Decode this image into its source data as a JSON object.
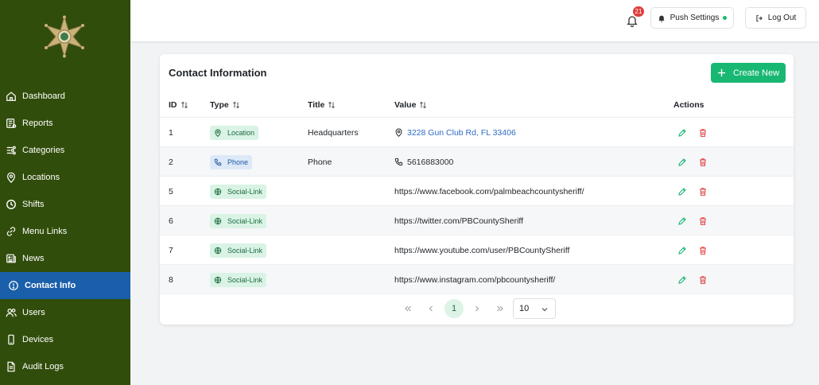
{
  "sidebar": {
    "items": [
      {
        "label": "Dashboard"
      },
      {
        "label": "Reports"
      },
      {
        "label": "Categories"
      },
      {
        "label": "Locations"
      },
      {
        "label": "Shifts"
      },
      {
        "label": "Menu Links"
      },
      {
        "label": "News"
      },
      {
        "label": "Contact Info"
      },
      {
        "label": "Users"
      },
      {
        "label": "Devices"
      },
      {
        "label": "Audit Logs"
      }
    ],
    "active_index": 7,
    "background": "#314d0b",
    "active_color": "#1a5faa"
  },
  "header": {
    "notification_count": "21",
    "push_settings_label": "Push Settings",
    "logout_label": "Log Out"
  },
  "card": {
    "title": "Contact Information",
    "create_label": "Create New",
    "columns": {
      "id": "ID",
      "type": "Type",
      "title": "Title",
      "value": "Value",
      "actions": "Actions"
    },
    "rows": [
      {
        "id": "1",
        "type": "Location",
        "title": "Headquarters",
        "value": "3228 Gun Club Rd, FL 33406"
      },
      {
        "id": "2",
        "type": "Phone",
        "title": "Phone",
        "value": "5616883000"
      },
      {
        "id": "5",
        "type": "Social-Link",
        "title": "",
        "value": "https://www.facebook.com/palmbeachcountysheriff/"
      },
      {
        "id": "6",
        "type": "Social-Link",
        "title": "",
        "value": "https://twitter.com/PBCountySheriff"
      },
      {
        "id": "7",
        "type": "Social-Link",
        "title": "",
        "value": "https://www.youtube.com/user/PBCountySheriff"
      },
      {
        "id": "8",
        "type": "Social-Link",
        "title": "",
        "value": "https://www.instagram.com/pbcountysheriff/"
      }
    ]
  },
  "pagination": {
    "current_page": "1",
    "page_size": "10"
  },
  "colors": {
    "accent_green": "#18b873",
    "link_blue": "#2f6bc7",
    "delete_red": "#e24c4c"
  }
}
